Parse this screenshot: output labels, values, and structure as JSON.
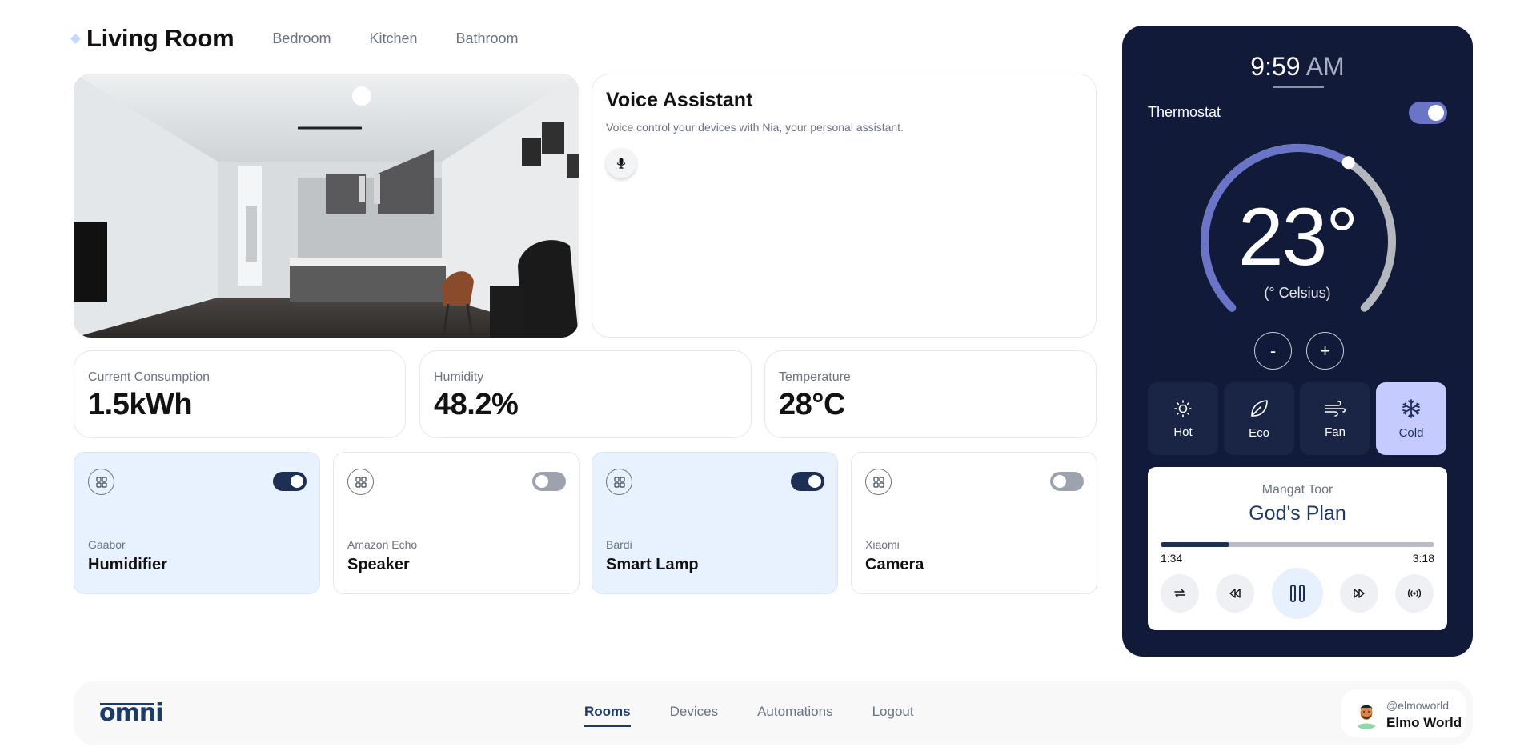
{
  "header": {
    "title": "Living Room",
    "tabs": [
      {
        "label": "Bedroom"
      },
      {
        "label": "Kitchen"
      },
      {
        "label": "Bathroom"
      }
    ]
  },
  "voice": {
    "title": "Voice Assistant",
    "description": "Voice control your devices with Nia, your personal assistant.",
    "mic_icon": "microphone-icon"
  },
  "stats": [
    {
      "label": "Current Consumption",
      "value": "1.5kWh"
    },
    {
      "label": "Humidity",
      "value": "48.2%"
    },
    {
      "label": "Temperature",
      "value": "28°C"
    }
  ],
  "devices": [
    {
      "brand": "Gaabor",
      "name": "Humidifier",
      "on": true,
      "icon": "grid-icon"
    },
    {
      "brand": "Amazon Echo",
      "name": "Speaker",
      "on": false,
      "icon": "grid-icon"
    },
    {
      "brand": "Bardi",
      "name": "Smart Lamp",
      "on": true,
      "icon": "grid-icon"
    },
    {
      "brand": "Xiaomi",
      "name": "Camera",
      "on": false,
      "icon": "grid-icon"
    }
  ],
  "thermostat": {
    "time": "9:59",
    "ampm": "AM",
    "label": "Thermostat",
    "enabled": true,
    "temperature": "23°",
    "unit": "(° Celsius)",
    "level_fraction": 0.62,
    "decrease_label": "-",
    "increase_label": "+",
    "modes": [
      {
        "label": "Hot",
        "icon": "sun-icon",
        "active": false
      },
      {
        "label": "Eco",
        "icon": "leaf-icon",
        "active": false
      },
      {
        "label": "Fan",
        "icon": "wind-icon",
        "active": false
      },
      {
        "label": "Cold",
        "icon": "snowflake-icon",
        "active": true
      }
    ]
  },
  "player": {
    "artist": "Mangat Toor",
    "song": "God's Plan",
    "elapsed": "1:34",
    "duration": "3:18",
    "progress_fraction": 0.25
  },
  "nav": {
    "logo": "omni",
    "links": [
      {
        "label": "Rooms",
        "active": true
      },
      {
        "label": "Devices",
        "active": false
      },
      {
        "label": "Automations",
        "active": false
      },
      {
        "label": "Logout",
        "active": false
      }
    ]
  },
  "user": {
    "handle": "@elmoworld",
    "name": "Elmo World"
  },
  "colors": {
    "panel": "#121a3a",
    "accent": "#6a75c7",
    "navy": "#1e2f55",
    "device_on_bg": "#e8f1fe",
    "cold_mode": "#c5cbff"
  }
}
